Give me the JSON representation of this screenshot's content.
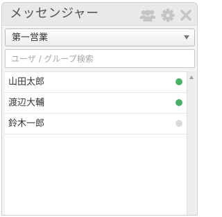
{
  "header": {
    "title": "メッセンジャー",
    "icons": [
      "users-icon",
      "gear-icon",
      "close-icon"
    ],
    "icon_color": "#c4c4c4"
  },
  "group_select": {
    "selected": "第一営業"
  },
  "search": {
    "placeholder": "ユーザ / グループ検索",
    "value": ""
  },
  "users": [
    {
      "name": "山田太郎",
      "status": "online",
      "status_color": "#4caf68"
    },
    {
      "name": "渡辺大輔",
      "status": "online",
      "status_color": "#4caf68"
    },
    {
      "name": "鈴木一郎",
      "status": "offline",
      "status_color": "#d9d9d9"
    }
  ]
}
